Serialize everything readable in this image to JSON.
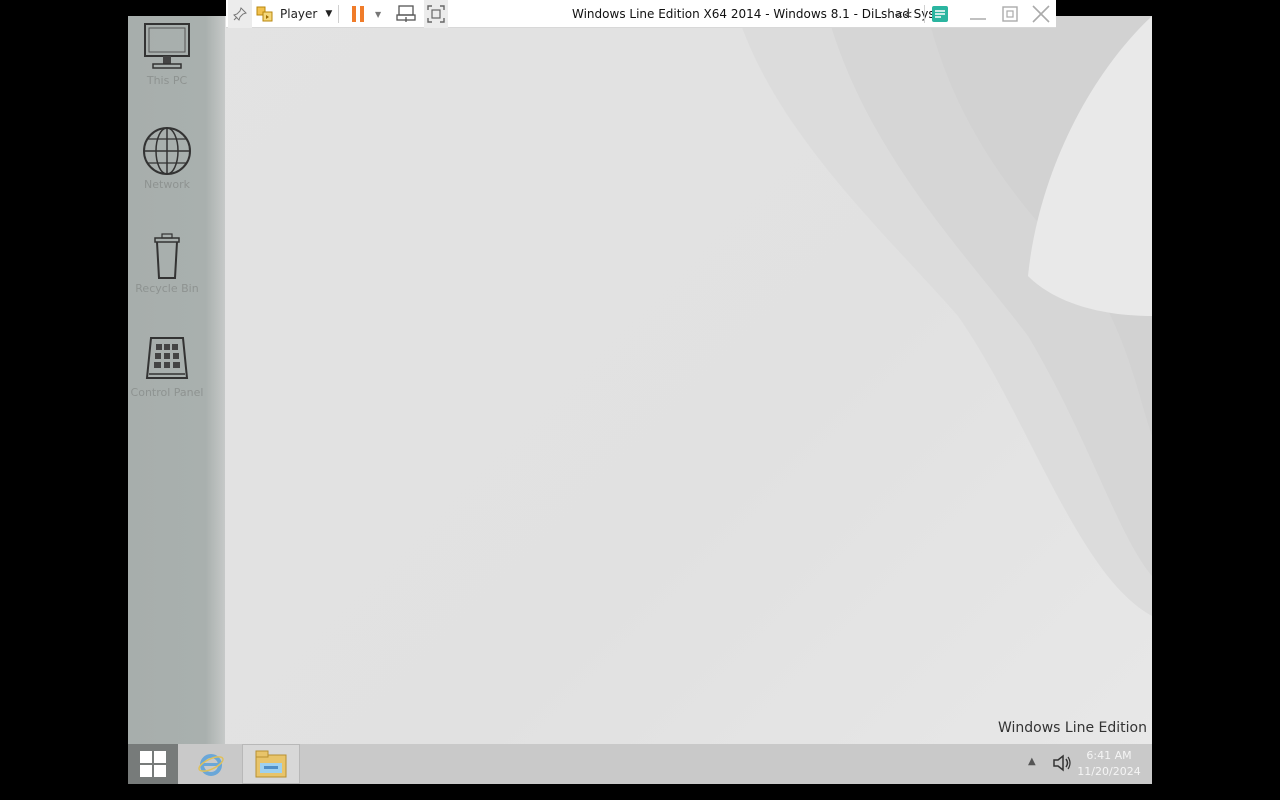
{
  "vm_toolbar": {
    "player_label": "Player",
    "title": "Windows Line Edition X64 2014 - Windows 8.1 - DiLshad Sys",
    "icons": [
      "pin-icon",
      "player-icon",
      "dropdown-arrow-icon",
      "pause-icon",
      "send-ctrl-alt-del-icon",
      "fullscreen-icon",
      "collapse-icon",
      "notes-icon",
      "minimize-icon",
      "restore-icon",
      "close-icon"
    ],
    "accent_color": "#f07c2a"
  },
  "desktop": {
    "icons": [
      {
        "label": "This PC",
        "icon": "monitor-icon"
      },
      {
        "label": "Network",
        "icon": "globe-icon"
      },
      {
        "label": "Recycle Bin",
        "icon": "recycle-bin-icon"
      },
      {
        "label": "Control Panel",
        "icon": "control-panel-icon"
      }
    ],
    "watermark": "Windows Line Edition"
  },
  "taskbar": {
    "start_icon": "windows-logo-icon",
    "pinned": [
      "internet-explorer-icon",
      "file-explorer-icon"
    ],
    "clock_time": "6:41 AM",
    "clock_date": "11/20/2024",
    "tray_icons": [
      "tray-chevron-icon",
      "volume-icon"
    ]
  }
}
